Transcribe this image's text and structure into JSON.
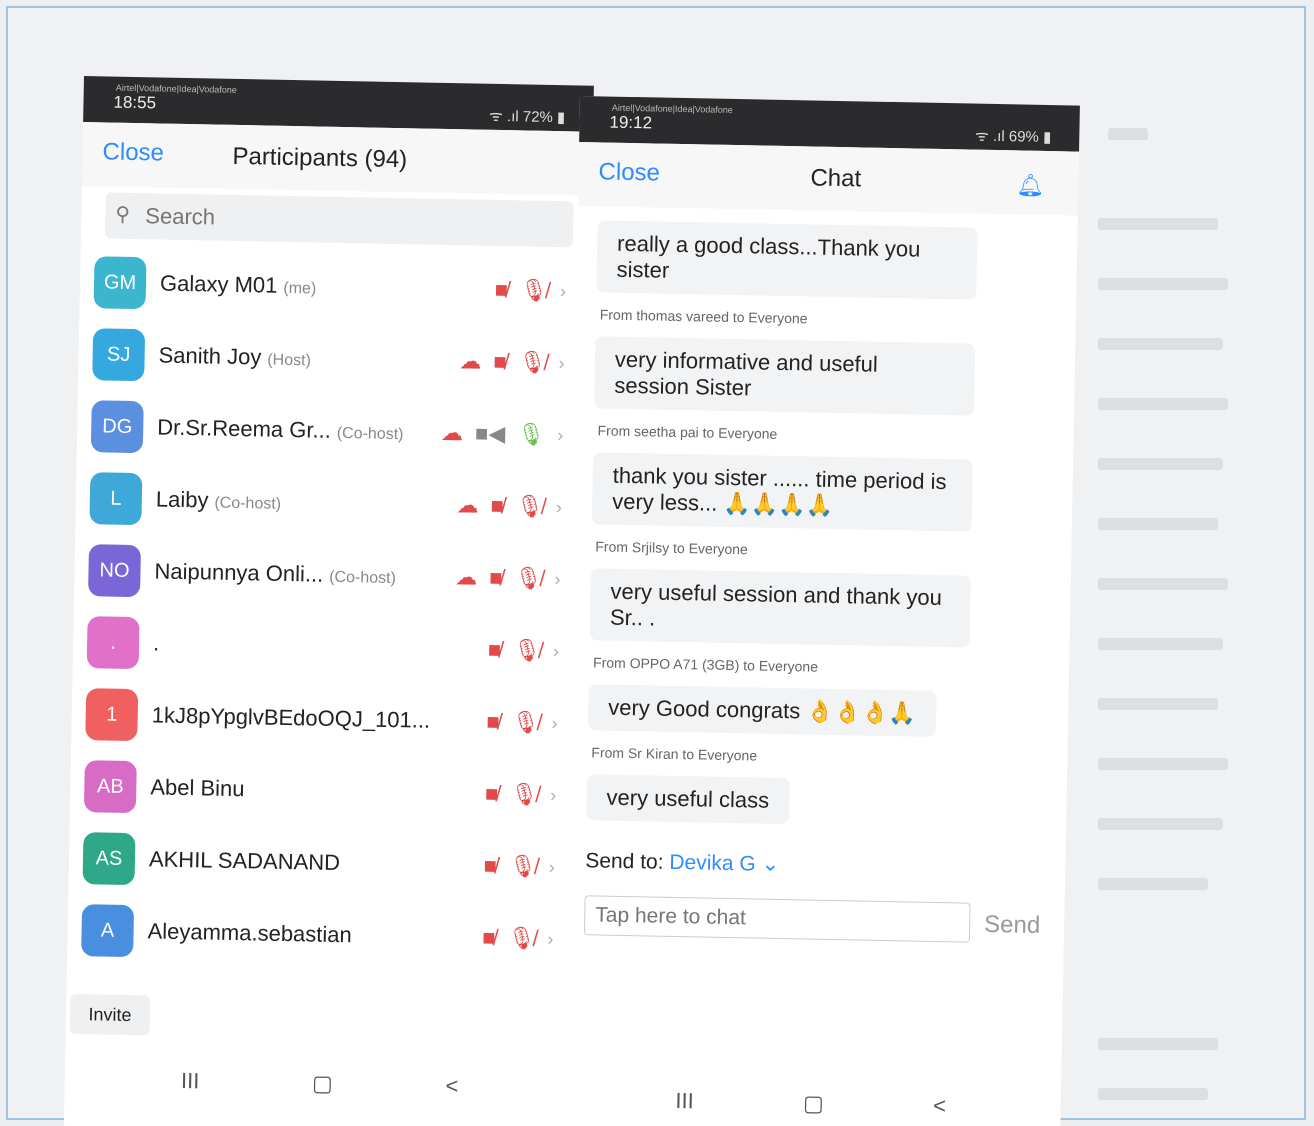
{
  "left": {
    "status": {
      "carrier": "Airtel|Vodafone|Idea|Vodafone",
      "time": "18:55",
      "signal": "ᯤ .ıl",
      "battery": "72%"
    },
    "close_label": "Close",
    "title": "Participants (94)",
    "search_placeholder": "Search",
    "participants": [
      {
        "initials": "GM",
        "name": "Galaxy M01",
        "role": "(me)",
        "color": "#3cb5cf",
        "cloud": false,
        "cam": "off",
        "mic": "off"
      },
      {
        "initials": "SJ",
        "name": "Sanith Joy",
        "role": "(Host)",
        "color": "#36a8e0",
        "cloud": true,
        "cam": "off",
        "mic": "off"
      },
      {
        "initials": "DG",
        "name": "Dr.Sr.Reema Gr...",
        "role": "(Co-host)",
        "color": "#5b8fe0",
        "cloud": true,
        "cam": "on",
        "mic": "on"
      },
      {
        "initials": "L",
        "name": "Laiby",
        "role": "(Co-host)",
        "color": "#3ea9d8",
        "cloud": true,
        "cam": "off",
        "mic": "off"
      },
      {
        "initials": "NO",
        "name": "Naipunnya Onli...",
        "role": "(Co-host)",
        "color": "#7a66d6",
        "cloud": true,
        "cam": "off",
        "mic": "off"
      },
      {
        "initials": ".",
        "name": ".",
        "role": "",
        "color": "#e070c8",
        "cloud": false,
        "cam": "off",
        "mic": "off"
      },
      {
        "initials": "1",
        "name": "1kJ8pYpglvBEdoOQJ_101...",
        "role": "",
        "color": "#f06060",
        "cloud": false,
        "cam": "off",
        "mic": "off"
      },
      {
        "initials": "AB",
        "name": "Abel Binu",
        "role": "",
        "color": "#d86cc4",
        "cloud": false,
        "cam": "off",
        "mic": "off"
      },
      {
        "initials": "AS",
        "name": "AKHIL SADANAND",
        "role": "",
        "color": "#2fa88a",
        "cloud": false,
        "cam": "off",
        "mic": "off"
      },
      {
        "initials": "A",
        "name": "Aleyamma.sebastian",
        "role": "",
        "color": "#4a8ee0",
        "cloud": false,
        "cam": "off",
        "mic": "off"
      }
    ],
    "invite_label": "Invite",
    "nav": [
      "III",
      "▢",
      "<"
    ]
  },
  "right": {
    "status": {
      "carrier": "Airtel|Vodafone|Idea|Vodafone",
      "time": "19:12",
      "signal": "ᯤ .ıl",
      "battery": "69%"
    },
    "close_label": "Close",
    "title": "Chat",
    "messages": [
      {
        "sender": "",
        "text": "really a good class...Thank you sister"
      },
      {
        "sender": "From thomas vareed to Everyone",
        "text": "very informative and useful session Sister"
      },
      {
        "sender": "From seetha pai to Everyone",
        "text": "thank  you  sister ...... time period is very less... 🙏🙏🙏🙏"
      },
      {
        "sender": "From Srjilsy to Everyone",
        "text": "very useful session and thank you Sr.. ."
      },
      {
        "sender": "From OPPO A71 (3GB) to Everyone",
        "text": "very Good congrats 👌👌👌🙏"
      },
      {
        "sender": "From Sr Kiran to Everyone",
        "text": "very useful class"
      }
    ],
    "send_to_label": "Send to:",
    "send_to_name": "Devika G",
    "chat_placeholder": "Tap here to chat",
    "send_label": "Send",
    "nav": [
      "III",
      "▢",
      "<"
    ]
  },
  "colors": {
    "accent": "#2d8cff",
    "muted_red": "#e24a4a",
    "unmuted_green": "#6ac14b"
  }
}
